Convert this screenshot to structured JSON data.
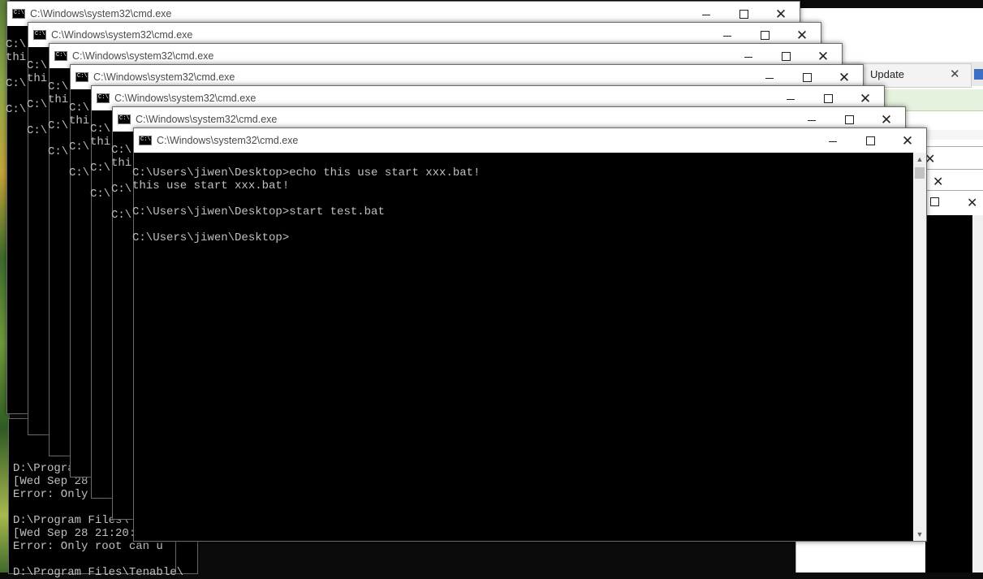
{
  "cmd_title": "C:\\Windows\\system32\\cmd.exe",
  "glyphs": {
    "close": "✕",
    "scroll_up": "▲",
    "scroll_down": "▼"
  },
  "windows": [
    {
      "lines": [
        "C:\\",
        "thi",
        "",
        "C:\\",
        "",
        "C:\\"
      ]
    },
    {
      "lines": [
        "C:\\",
        "thi",
        "",
        "C:\\",
        "",
        "C:\\"
      ]
    },
    {
      "lines": [
        "C:\\",
        "thi",
        "",
        "C:\\",
        "",
        "C:\\"
      ]
    },
    {
      "lines": [
        "C:\\",
        "thi",
        "",
        "C:\\",
        "",
        "C:\\"
      ]
    },
    {
      "lines": [
        "C:\\",
        "thi",
        "",
        "C:\\",
        "",
        "C:\\"
      ]
    },
    {
      "lines": [
        "C:\\",
        "thi",
        "",
        "C:\\",
        "",
        "C:\\"
      ]
    },
    {
      "lines": [
        "C:\\Users\\jiwen\\Desktop>echo this use start xxx.bat!",
        "this use start xxx.bat!",
        "",
        "C:\\Users\\jiwen\\Desktop>start test.bat",
        "",
        "C:\\Users\\jiwen\\Desktop>"
      ]
    }
  ],
  "background_console": {
    "lines": [
      "D:\\Program",
      "[Wed Sep 28",
      "Error: Only",
      "",
      "D:\\Program Files\\",
      "[Wed Sep 28 21:20:1",
      "Error: Only root can u",
      "",
      "D:\\Program Files\\Tenable\\"
    ]
  },
  "background_browser_tab": {
    "label": "Update",
    "close": "✕"
  }
}
